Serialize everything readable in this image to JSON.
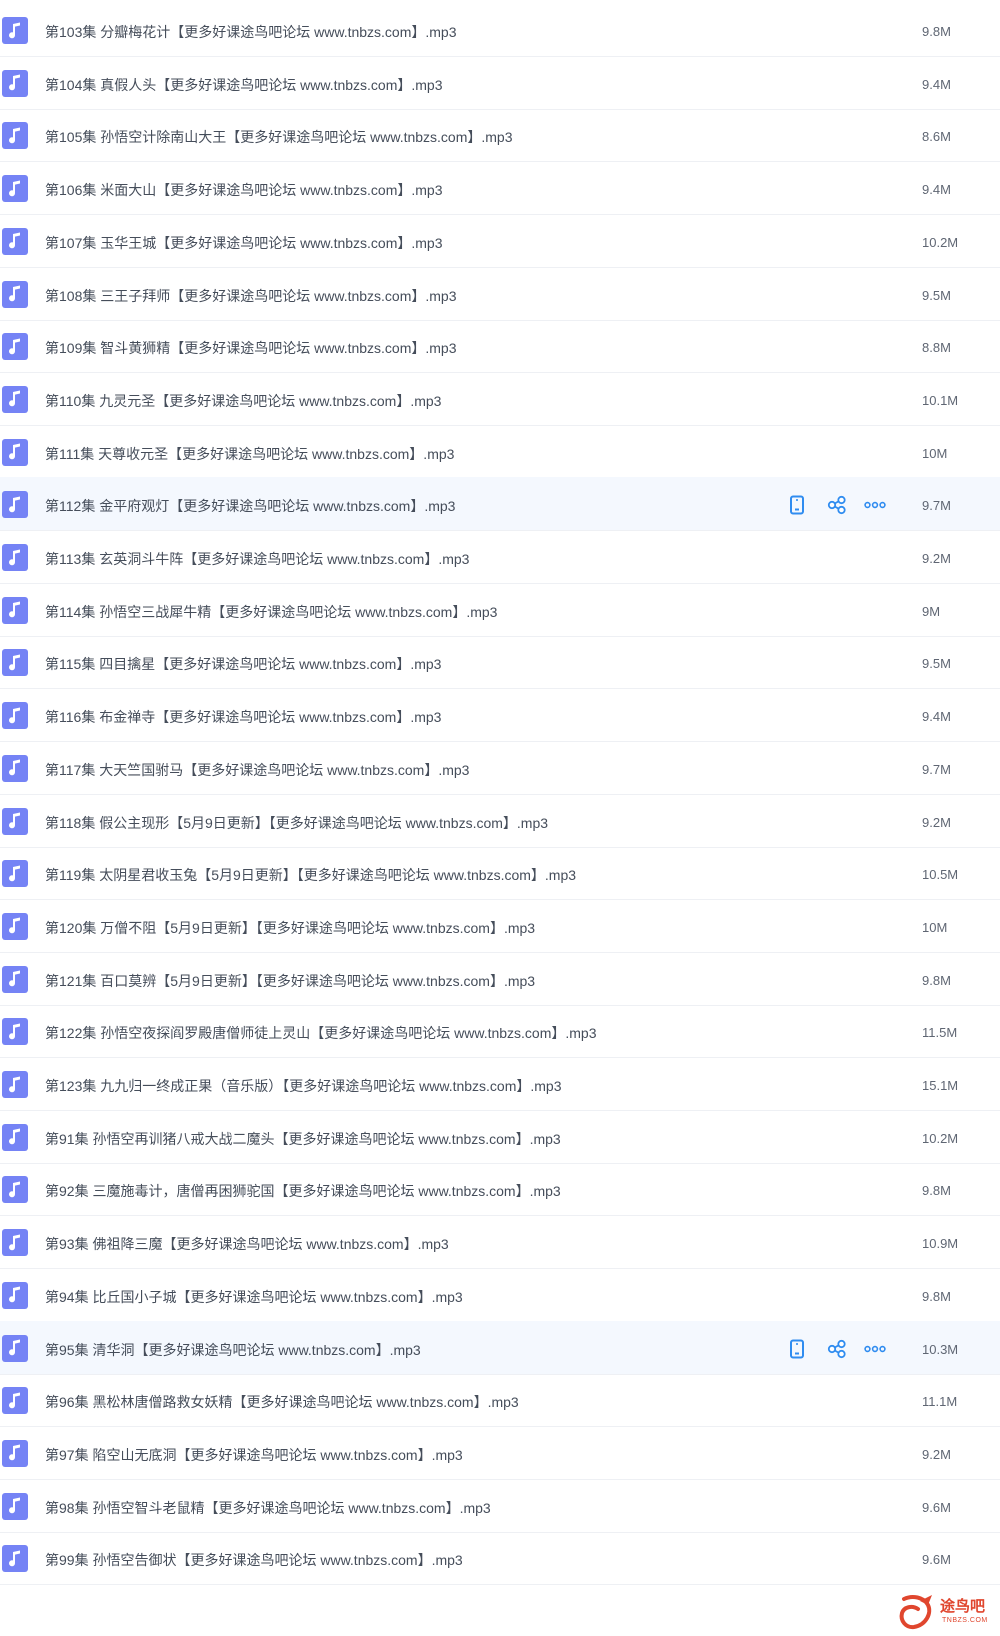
{
  "colors": {
    "icon_bg": "#7583f5",
    "row_hover_bg": "#f4f8fe",
    "action_icon": "#2f8cf0",
    "watermark": "#e0462e"
  },
  "files": [
    {
      "name": "第103集 分瓣梅花计【更多好课途鸟吧论坛 www.tnbzs.com】.mp3",
      "size": "9.8M"
    },
    {
      "name": "第104集 真假人头【更多好课途鸟吧论坛 www.tnbzs.com】.mp3",
      "size": "9.4M"
    },
    {
      "name": "第105集 孙悟空计除南山大王【更多好课途鸟吧论坛 www.tnbzs.com】.mp3",
      "size": "8.6M"
    },
    {
      "name": "第106集 米面大山【更多好课途鸟吧论坛 www.tnbzs.com】.mp3",
      "size": "9.4M"
    },
    {
      "name": "第107集 玉华王城【更多好课途鸟吧论坛 www.tnbzs.com】.mp3",
      "size": "10.2M"
    },
    {
      "name": "第108集 三王子拜师【更多好课途鸟吧论坛 www.tnbzs.com】.mp3",
      "size": "9.5M"
    },
    {
      "name": "第109集 智斗黄狮精【更多好课途鸟吧论坛 www.tnbzs.com】.mp3",
      "size": "8.8M"
    },
    {
      "name": "第110集 九灵元圣【更多好课途鸟吧论坛 www.tnbzs.com】.mp3",
      "size": "10.1M"
    },
    {
      "name": "第111集 天尊收元圣【更多好课途鸟吧论坛 www.tnbzs.com】.mp3",
      "size": "10M"
    },
    {
      "name": "第112集 金平府观灯【更多好课途鸟吧论坛 www.tnbzs.com】.mp3",
      "size": "9.7M"
    },
    {
      "name": "第113集 玄英洞斗牛阵【更多好课途鸟吧论坛 www.tnbzs.com】.mp3",
      "size": "9.2M"
    },
    {
      "name": "第114集 孙悟空三战犀牛精【更多好课途鸟吧论坛 www.tnbzs.com】.mp3",
      "size": "9M"
    },
    {
      "name": "第115集 四目擒星【更多好课途鸟吧论坛 www.tnbzs.com】.mp3",
      "size": "9.5M"
    },
    {
      "name": "第116集 布金禅寺【更多好课途鸟吧论坛 www.tnbzs.com】.mp3",
      "size": "9.4M"
    },
    {
      "name": "第117集 大天竺国驸马【更多好课途鸟吧论坛 www.tnbzs.com】.mp3",
      "size": "9.7M"
    },
    {
      "name": "第118集 假公主现形【5月9日更新】【更多好课途鸟吧论坛 www.tnbzs.com】.mp3",
      "size": "9.2M"
    },
    {
      "name": "第119集 太阴星君收玉兔【5月9日更新】【更多好课途鸟吧论坛 www.tnbzs.com】.mp3",
      "size": "10.5M"
    },
    {
      "name": "第120集 万僧不阻【5月9日更新】【更多好课途鸟吧论坛 www.tnbzs.com】.mp3",
      "size": "10M"
    },
    {
      "name": "第121集 百口莫辨【5月9日更新】【更多好课途鸟吧论坛 www.tnbzs.com】.mp3",
      "size": "9.8M"
    },
    {
      "name": "第122集 孙悟空夜探阎罗殿唐僧师徒上灵山【更多好课途鸟吧论坛 www.tnbzs.com】.mp3",
      "size": "11.5M"
    },
    {
      "name": "第123集 九九归一终成正果（音乐版）【更多好课途鸟吧论坛 www.tnbzs.com】.mp3",
      "size": "15.1M"
    },
    {
      "name": "第91集 孙悟空再训猪八戒大战二魔头【更多好课途鸟吧论坛 www.tnbzs.com】.mp3",
      "size": "10.2M"
    },
    {
      "name": "第92集 三魔施毒计，唐僧再困狮驼国【更多好课途鸟吧论坛 www.tnbzs.com】.mp3",
      "size": "9.8M"
    },
    {
      "name": "第93集 佛祖降三魔【更多好课途鸟吧论坛 www.tnbzs.com】.mp3",
      "size": "10.9M"
    },
    {
      "name": "第94集 比丘国小子城【更多好课途鸟吧论坛 www.tnbzs.com】.mp3",
      "size": "9.8M"
    },
    {
      "name": "第95集 清华洞【更多好课途鸟吧论坛 www.tnbzs.com】.mp3",
      "size": "10.3M"
    },
    {
      "name": "第96集 黑松林唐僧路救女妖精【更多好课途鸟吧论坛 www.tnbzs.com】.mp3",
      "size": "11.1M"
    },
    {
      "name": "第97集 陷空山无底洞【更多好课途鸟吧论坛 www.tnbzs.com】.mp3",
      "size": "9.2M"
    },
    {
      "name": "第98集 孙悟空智斗老鼠精【更多好课途鸟吧论坛 www.tnbzs.com】.mp3",
      "size": "9.6M"
    },
    {
      "name": "第99集 孙悟空告御状【更多好课途鸟吧论坛 www.tnbzs.com】.mp3",
      "size": "9.6M"
    }
  ],
  "hover_rows": [
    9,
    25
  ],
  "icons": {
    "file": "music-note-icon",
    "phone": "phone-icon",
    "share": "share-icon",
    "more": "more-icon"
  },
  "watermark": {
    "text": "途鸟吧",
    "sub": "TNBZS.COM"
  }
}
